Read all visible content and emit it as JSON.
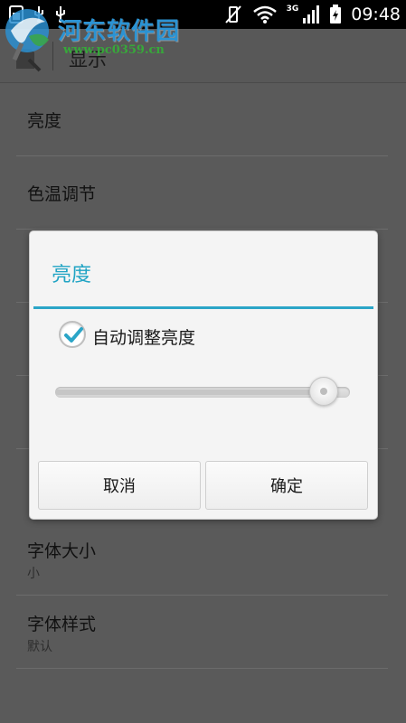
{
  "status_bar": {
    "time": "09:48",
    "network_label": "3G",
    "icons": [
      "sim-icon",
      "usb-icon",
      "usb-icon",
      "vibrate-mute-icon",
      "wifi-icon",
      "signal-icon",
      "battery-icon"
    ]
  },
  "watermark": {
    "title": "河东软件园",
    "url": "www.pc0359.cn"
  },
  "action_bar": {
    "title": "显示",
    "back_icon": "settings-back-icon"
  },
  "settings": {
    "items": [
      {
        "label": "亮度"
      },
      {
        "label": "色温调节"
      },
      {
        "label": "字体大小",
        "summary": "小"
      },
      {
        "label": "字体样式",
        "summary": "默认"
      }
    ]
  },
  "dialog": {
    "title": "亮度",
    "auto_brightness_label": "自动调整亮度",
    "auto_brightness_checked": true,
    "brightness_level": 0.95,
    "cancel_label": "取消",
    "ok_label": "确定"
  },
  "colors": {
    "accent": "#2ba5c7",
    "status_bar_bg": "#000000",
    "dimmed_background": "#5a5a5a",
    "dialog_bg": "#f4f4f4"
  }
}
